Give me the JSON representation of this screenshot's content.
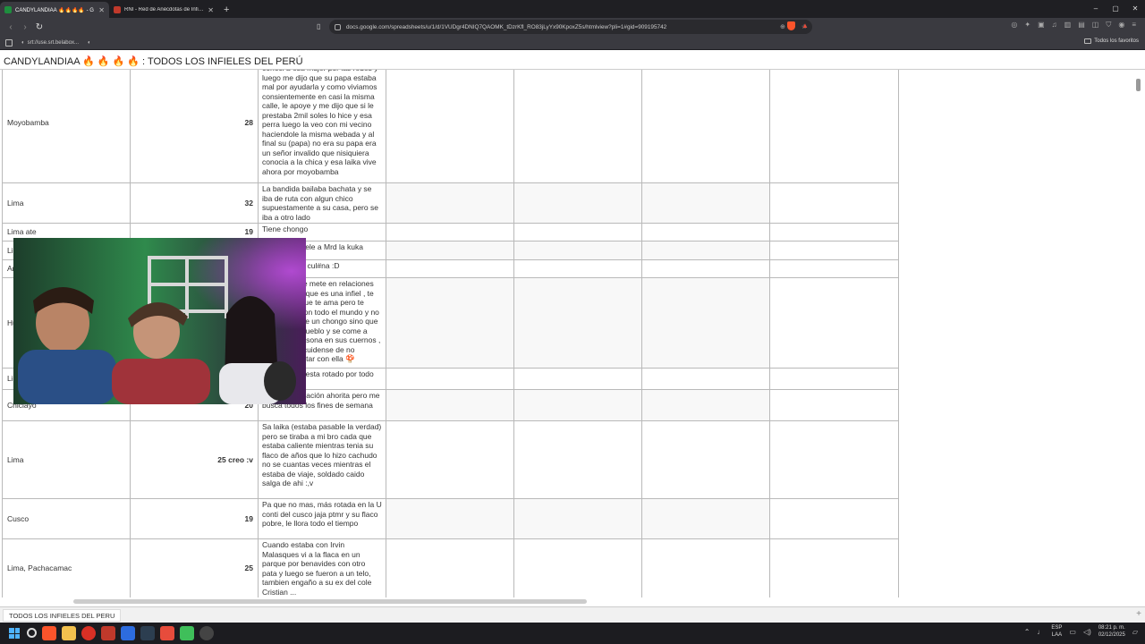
{
  "browser": {
    "tabs": [
      {
        "title": "CANDYLANDIAA 🔥🔥🔥🔥 - G",
        "active": true,
        "color": "#1e8e3e"
      },
      {
        "title": "RNI - Red de Anécdotas de Infidelida",
        "active": false,
        "color": "#c0392b"
      }
    ],
    "new_tab": "+",
    "url": "docs.google.com/spreadsheets/u/1/d/1VUDgr4DNIQ7QAOMK_tDzrKfl_RO83jLyYx90KpoxZ5s/htmlview?pli=1#gid=909195742",
    "bookmark": "srt://use.srt.belabox...",
    "favorites": "Todos los favoritos",
    "window_controls": {
      "minimize": "–",
      "maximize": "▢",
      "close": "✕"
    }
  },
  "sheet": {
    "title": "CANDYLANDIAA 🔥 🔥 🔥 🔥 : TODOS LOS INFIELES DEL PERÚ",
    "rows": [
      {
        "city": "Moyobamba",
        "age": "28",
        "story": "conoci a esa mujer por las redes y luego me dijo que su papa estaba mal por ayudarla y como viviamos consientemente en casi la misma calle, le apoye y me dijo que si le prestaba 2mil soles lo hice y esa perra luego la veo con mi vecino haciendole la misma webada y al final su (papa) no era su papa era un señor invalido que nisiquiera conocia a la chica y esa laika vive ahora por moyobamba"
      },
      {
        "city": "Lima",
        "age": "32",
        "story": "La bandida bailaba bachata y se iba de ruta con algun chico supuestamente a su casa, pero se iba a otro lado"
      },
      {
        "city": "Lima ate",
        "age": "19",
        "story": "Tiene chongo"
      },
      {
        "city": "Lima",
        "age": "",
        "story": "Es laika y huele a Mrd la kuka"
      },
      {
        "city": "Arequipa",
        "age": "",
        "story": "Es una zorra cul#na :D"
      },
      {
        "city": "Huancayo",
        "age": "",
        "story": "Esta chica se mete en relaciones sabiendo de que es una infiel , te hace creer que te ama pero te engaña de con todo el mundo y no solo le parece un chongo sino que con todo el pueblo y se come a cualquier persona en sus cuernos , sin corazon cuidense de no meterse a estar con ella 🍄"
      },
      {
        "city": "Lima",
        "age": "",
        "story": "Es una laika,esta rotado por todo"
      },
      {
        "city": "Chiclayo",
        "age": "20",
        "story": "Tiene una relación ahorita pero me busca todos los fines de semana"
      },
      {
        "city": "Lima",
        "age": "25 creo :v",
        "story": "Sa laika (estaba pasable la verdad) pero se tiraba a mi bro cada que estaba caliente mientras tenia su flaco de años que lo hizo cachudo no se cuantas veces mientras el estaba de viaje, soldado caido salga de ahi :,v"
      },
      {
        "city": "Cusco",
        "age": "19",
        "story": "Pa que no mas, más rotada en la U conti del cusco jaja ptmr y su flaco pobre, le llora todo el tiempo"
      },
      {
        "city": "Lima, Pachacamac",
        "age": "25",
        "story": "Cuando estaba con Irvin Malasques vi a la flaca en un parque por benavides con otro pata y luego se fueron a un telo, tambien engaño a su ex del cole Cristian ..."
      }
    ],
    "sheet_tab": "TODOS LOS INFIELES DEL PERU",
    "add_sheet": "+"
  },
  "taskbar": {
    "lang_top": "ESP",
    "lang_bottom": "LAA",
    "time": "08:21 p. m.",
    "date": "02/12/2025"
  },
  "colors": {
    "accent": "#1e8e3e",
    "brave": "#fb542b"
  }
}
